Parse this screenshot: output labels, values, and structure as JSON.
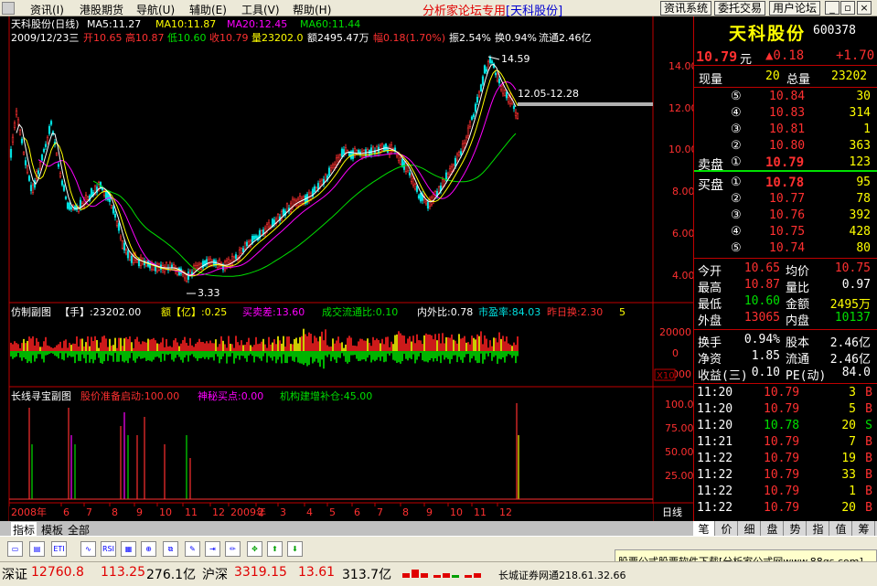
{
  "menu": {
    "items": [
      "资讯(I)",
      "港股期货",
      "导航(U)",
      "辅助(E)",
      "工具(V)",
      "帮助(H)"
    ],
    "forum_title": "分析家论坛专用",
    "stock_bracket": "[天科股份]",
    "buttons": [
      "资讯系统",
      "委托交易",
      "用户论坛"
    ]
  },
  "chart_header": {
    "name": "天科股份(日线)",
    "ma5": "MA5:11.27",
    "ma10": "MA10:11.87",
    "ma20": "MA20:12.45",
    "ma60": "MA60:11.44",
    "date": "2009/12/23三",
    "open": "开10.65",
    "high": "高10.87",
    "low": "低10.60",
    "close": "收10.79",
    "vol": "量23202.0",
    "amount": "额2495.47万",
    "range": "幅0.18(1.70%)",
    "amp": "振2.54%",
    "turn": "换0.94%",
    "float": "流通2.46亿"
  },
  "chart_data": {
    "type": "candlestick",
    "y_ticks": [
      "14.00",
      "12.00",
      "10.00",
      "8.00",
      "6.00",
      "4.00"
    ],
    "annotations": [
      "14.59",
      "12.05-12.28",
      "3.33"
    ],
    "x_ticks": [
      "2008年",
      "6",
      "7",
      "8",
      "9",
      "10",
      "11",
      "12",
      "2009年",
      "2",
      "3",
      "4",
      "5",
      "6",
      "7",
      "8",
      "9",
      "10",
      "11",
      "12"
    ],
    "period": "日线",
    "colors": {
      "up": "#ff3030",
      "down": "#00e0e0",
      "ma5": "#ffffff",
      "ma10": "#ffff00",
      "ma20": "#ff00ff",
      "ma60": "#00e000"
    }
  },
  "sub1": {
    "title": "仿制副图",
    "hand": "【手】:23202.00",
    "yi": "额【亿】:0.25",
    "buysell": "买卖差:13.60",
    "circ": "成交流通比:0.10",
    "inout": "内外比:0.78",
    "pe": "市盈率:84.03",
    "yest": "昨日换:2.30",
    "five": "5",
    "y_labels": [
      "20000",
      "0",
      "-20000"
    ],
    "x10": "X10"
  },
  "sub2": {
    "title": "长线寻宝副图",
    "prep": "股价准备启动:100.00",
    "mystery": "神秘买点:0.00",
    "inst": "机构建增补仓:45.00",
    "y_labels": [
      "100.0",
      "75.00",
      "50.00",
      "25.00"
    ]
  },
  "panel": {
    "title": "天科股份",
    "code": "600378",
    "price": "10.79",
    "unit": "元",
    "change": "▲0.18",
    "change2": "+1.70",
    "current_vol_label": "现量",
    "current_vol": "20",
    "total_vol_label": "总量",
    "total_vol": "23202",
    "asks": [
      {
        "lvl": "⑤",
        "price": "10.84",
        "vol": "30"
      },
      {
        "lvl": "④",
        "price": "10.83",
        "vol": "314"
      },
      {
        "lvl": "③",
        "price": "10.81",
        "vol": "1"
      },
      {
        "lvl": "②",
        "price": "10.80",
        "vol": "363"
      },
      {
        "lvl": "①",
        "price": "10.79",
        "vol": "123",
        "label": "卖盘"
      }
    ],
    "bids": [
      {
        "lvl": "①",
        "price": "10.78",
        "vol": "95",
        "label": "买盘"
      },
      {
        "lvl": "②",
        "price": "10.77",
        "vol": "78"
      },
      {
        "lvl": "③",
        "price": "10.76",
        "vol": "392"
      },
      {
        "lvl": "④",
        "price": "10.75",
        "vol": "428"
      },
      {
        "lvl": "⑤",
        "price": "10.74",
        "vol": "80"
      }
    ],
    "stats": [
      {
        "l1": "今开",
        "v1": "10.65",
        "l2": "均价",
        "v2": "10.75"
      },
      {
        "l1": "最高",
        "v1": "10.87",
        "l2": "量比",
        "v2": "0.97"
      },
      {
        "l1": "最低",
        "v1": "10.60",
        "l2": "金额",
        "v2": "2495万"
      },
      {
        "l1": "外盘",
        "v1": "13065",
        "l2": "内盘",
        "v2": "10137"
      }
    ],
    "stats2": [
      {
        "l1": "换手",
        "v1": "0.94%",
        "l2": "股本",
        "v2": "2.46亿"
      },
      {
        "l1": "净资",
        "v1": "1.85",
        "l2": "流通",
        "v2": "2.46亿"
      },
      {
        "l1": "收益(三)",
        "v1": "0.10",
        "l2": "PE(动)",
        "v2": "84.0"
      }
    ],
    "ticks": [
      {
        "time": "11:20",
        "price": "10.79",
        "vol": "3",
        "bs": "B"
      },
      {
        "time": "11:20",
        "price": "10.79",
        "vol": "5",
        "bs": "B"
      },
      {
        "time": "11:20",
        "price": "10.78",
        "vol": "20",
        "bs": "S"
      },
      {
        "time": "11:21",
        "price": "10.79",
        "vol": "7",
        "bs": "B"
      },
      {
        "time": "11:22",
        "price": "10.79",
        "vol": "19",
        "bs": "B"
      },
      {
        "time": "11:22",
        "price": "10.79",
        "vol": "33",
        "bs": "B"
      },
      {
        "time": "11:22",
        "price": "10.79",
        "vol": "1",
        "bs": "B"
      },
      {
        "time": "11:22",
        "price": "10.79",
        "vol": "20",
        "bs": "B"
      }
    ],
    "tabs": [
      "笔",
      "价",
      "细",
      "盘",
      "势",
      "指",
      "值",
      "筹"
    ]
  },
  "left_tabs": [
    "指标",
    "模板",
    "全部"
  ],
  "status": {
    "sz_label": "深证",
    "sz_val": "12760.8",
    "sz_chg": "113.25",
    "sz_amt": "276.1亿",
    "hs_label": "沪深",
    "hs_val": "3319.15",
    "hs_chg": "13.61",
    "hs_amt": "313.7亿",
    "broker": "长城证券网通218.61.32.66",
    "ad": "股票公式股票软件下载[分析家公式网www.88gs.com]"
  }
}
